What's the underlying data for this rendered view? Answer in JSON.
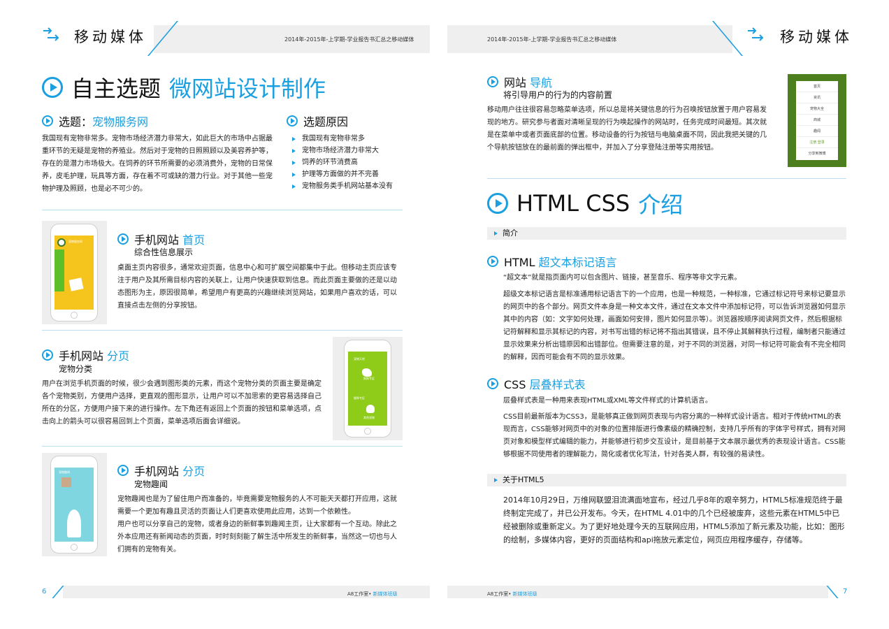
{
  "header": {
    "brand": "移动媒体",
    "subtitle_left": "2014年-2015年-上学期-学业报告书汇总之移动媒体",
    "subtitle_right": "2014年-2015年-上学期-学业报告书汇总之移动媒体"
  },
  "left": {
    "main_title_black": "自主选题",
    "main_title_blue": "微网站设计制作",
    "topic": {
      "label": "选题：",
      "value": "宠物服务网",
      "body": "我国现有宠物非常多。宠物市场经济潜力非常大，如此巨大的市场中占据最重环节的无疑是宠物的养殖业。然后对于宠物的日照照顾以及美容养护等，存在的是潜力市场极大。在饲养的环节所需要的必须消费外，宠物的日常保养，皮毛护理，玩具等方面，存在着不可或缺的潜力行业。对于其他一些宠物护理及照顾，也是必不可少的。"
    },
    "reasons": {
      "title": "选题原因",
      "items": [
        "我国现有宠物非常多",
        "宠物市场经济潜力非常大",
        "饲养的环节消费高",
        "护理等方面做的并不完善",
        "宠物服务类手机网站基本没有"
      ]
    },
    "home": {
      "title_black": "手机网站",
      "title_blue": "首页",
      "subtitle": "综合性信息展示",
      "body": "桌面主页内容很多，通常欢迎页面，信息中心和可扩展空间都集中于此。但移动主页应该专注于用户及其所需目标内容的关联上，让用户快速获取到信息。而此页面主要做的还是以动态图形为主，原因很简单，希望用户有更高的兴趣继续浏览网站，如果用户喜欢的话，可以直接点击左侧的分享按钮。",
      "screen_label": "宠物服务网"
    },
    "category": {
      "title_black": "手机网站",
      "title_blue": "分页",
      "subtitle": "宠物分类",
      "body": "用户在浏览手机页面的时候，很少会遇到图形类的元素，而这个宠物分类的页面主要是确定各个宠物类别，方便用户选择，更直观的图形显示，让用户可以不加思索的更容易选择自己所在的分区，方便用户接下来的进行操作。左下角还有返回上个页面的按钮和菜单选项，点击向上的箭头可以很容易回到上个页面，菜单选项后面会详细说。",
      "screen_items": [
        "宠物天地",
        "狗狗专区",
        "猫咪专区",
        "其他宠物"
      ]
    },
    "fun": {
      "title_black": "手机网站",
      "title_blue": "分页",
      "subtitle": "宠物趣闻",
      "body1": "宠物趣闻也是为了留住用户而准备的，毕竟需要宠物服务的人不可能天天都打开应用，这就需要一个更加有趣且灵活的页面让人们更喜欢使用此应用，达到一个依赖性。",
      "body2": "用户也可以分享自己的宠物，或者身边的新鲜事到趣闻主页，让大家都有一个互动。除此之外本应用还有新闻动态的页面，时时刻刻能了解生活中所发生的新鲜事，当然这一切也与人们拥有的宠物有关。",
      "screen_label": "宠物趣闻"
    }
  },
  "right": {
    "nav": {
      "title_black": "网站",
      "title_blue": "导航",
      "subtitle": "将引导用户的行为的内容前置",
      "body": "移动用户往往很容易忽略菜单选项，所以总是将关键信息的行为召唤按钮放置于用户容易发现的地方。研究参与者面对清晰呈现的行为唤起操作的网站时，任务完成时间最短。其次就是在菜单中或者页面底部的位置。移动设备的行为按钮与电脑桌面不同，因此我把关键的几个导航按钮放在的最前面的弹出框中，并加入了分享登陆注册等实用按钮。",
      "menu": [
        "首页",
        "资讯",
        "宠物大全",
        "商城",
        "趣闻"
      ],
      "menu_footer": "注册  登录",
      "menu_share": "分享到微博"
    },
    "html_title_black": "HTML CSS",
    "html_title_blue": "介绍",
    "bar_intro": "简介",
    "html": {
      "title_black": "HTML",
      "title_blue": "超文本标记语言",
      "line1": "“超文本”就是指页面内可以包含图片、链接，甚至音乐、程序等非文字元素。",
      "body": "超级文本标记语言是标准通用标记语言下的一个应用，也是一种规范，一种标准，它通过标记符号来标记要显示的网页中的各个部分。网页文件本身是一种文本文件，通过在文本文件中添加标记符，可以告诉浏览器如何显示其中的内容（如：文字如何处理，画面如何安排，图片如何显示等）。浏览器按顺序阅读网页文件，然后根据标记符解释和显示其标记的内容，对书写出错的标记将不指出其错误，且不停止其解释执行过程，编制者只能通过显示效果来分析出错原因和出错部位。但需要注意的是，对于不同的浏览器，对同一标记符可能会有不完全相同的解释，因而可能会有不同的显示效果。"
    },
    "css": {
      "title_black": "CSS",
      "title_blue": "层叠样式表",
      "line1": "层叠样式表是一种用来表现HTML或XML等文件样式的计算机语言。",
      "body": "CSS目前最新版本为CSS3，是能够真正做到网页表现与内容分离的一种样式设计语言。相对于传统HTML的表现而言，CSS能够对网页中的对象的位置排版进行像素级的精确控制，支持几乎所有的字体字号样式，拥有对网页对象和模型样式编辑的能力，并能够进行初步交互设计，是目前基于文本展示最优秀的表现设计语言。CSS能够根据不同使用者的理解能力，简化或者优化写法，针对各类人群，有较强的易读性。"
    },
    "bar_html5": "关于HTML5",
    "html5_body": "2014年10月29日，万维网联盟泪流满面地宣布，经过几乎8年的艰辛努力，HTML5标准规范终于最终制定完成了，并已公开发布。今天，在HTML 4.01中的几个已经被废弃，这些元素在HTML5中已经被删除或重新定义。为了更好地处理今天的互联网应用，HTML5添加了新元素及功能，比如：图形的绘制，多媒体内容，更好的页面结构和api拖放元素定位，网页应用程序缓存，存储等。"
  },
  "footer": {
    "left_page": "6",
    "right_page": "7",
    "studio_left": "A8工作室•",
    "class_left": "新媒体班级",
    "studio_right": "A8工作室•",
    "class_right": "新媒体班级"
  },
  "colors": {
    "accent": "#1a9fe0",
    "band": "#efefef",
    "home_screen": "#f5c41d",
    "category_screen": "#8fcc1a",
    "fun_screen": "#7fd6e0",
    "nav_bg": "#4e7f1f"
  }
}
